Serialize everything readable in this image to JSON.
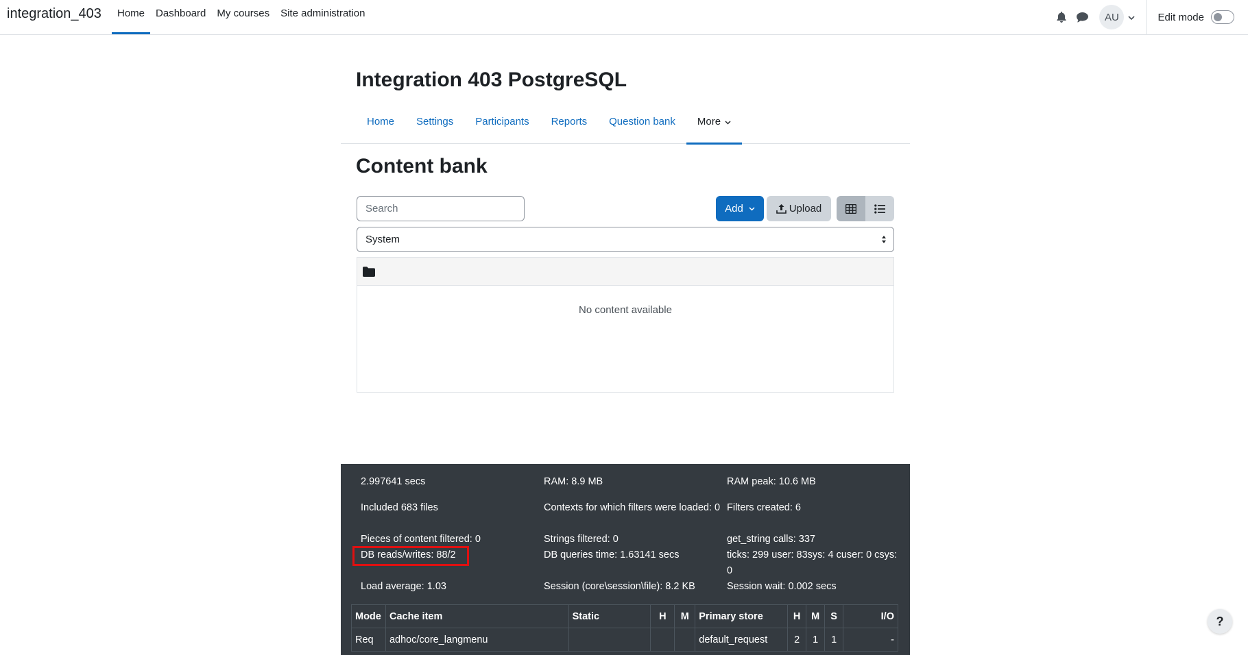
{
  "navbar": {
    "brand": "integration_403",
    "items": [
      {
        "label": "Home",
        "active": true
      },
      {
        "label": "Dashboard"
      },
      {
        "label": "My courses"
      },
      {
        "label": "Site administration"
      }
    ],
    "avatar_initials": "AU",
    "edit_mode_label": "Edit mode",
    "edit_mode_on": false
  },
  "course": {
    "title": "Integration 403 PostgreSQL",
    "tabs": [
      {
        "label": "Home"
      },
      {
        "label": "Settings"
      },
      {
        "label": "Participants"
      },
      {
        "label": "Reports"
      },
      {
        "label": "Question bank"
      },
      {
        "label": "More",
        "active": true
      }
    ]
  },
  "content_bank": {
    "heading": "Content bank",
    "search_placeholder": "Search",
    "add_label": "Add",
    "upload_label": "Upload",
    "context_selected": "System",
    "empty_message": "No content available"
  },
  "perf": {
    "time": "2.997641 secs",
    "ram": "RAM: 8.9 MB",
    "ram_peak": "RAM peak: 10.6 MB",
    "included_files": "Included 683 files",
    "contexts_filters": "Contexts for which filters were loaded: 0",
    "filters_created": "Filters created: 6",
    "pieces_filtered": "Pieces of content filtered: 0",
    "strings_filtered": "Strings filtered: 0",
    "get_string_calls": "get_string calls: 337",
    "db_reads_writes": "DB reads/writes: 88/2",
    "db_queries_time": "DB queries time: 1.63141 secs",
    "ticks": "ticks: 299 user: 83sys: 4 cuser: 0 csys: 0",
    "load_average": "Load average: 1.03",
    "session": "Session (core\\session\\file): 8.2 KB",
    "session_wait": "Session wait: 0.002 secs",
    "cache_table": {
      "headers": [
        "Mode",
        "Cache item",
        "Static",
        "H",
        "M",
        "Primary store",
        "H",
        "M",
        "S",
        "I/O"
      ],
      "rows": [
        [
          "Req",
          "adhoc/core_langmenu",
          "",
          "",
          "",
          "default_request",
          "2",
          "1",
          "1",
          "-"
        ]
      ]
    }
  },
  "help_label": "?",
  "colors": {
    "primary": "#0f6cbf",
    "footer_bg": "#343a40",
    "highlight": "#e01010"
  }
}
